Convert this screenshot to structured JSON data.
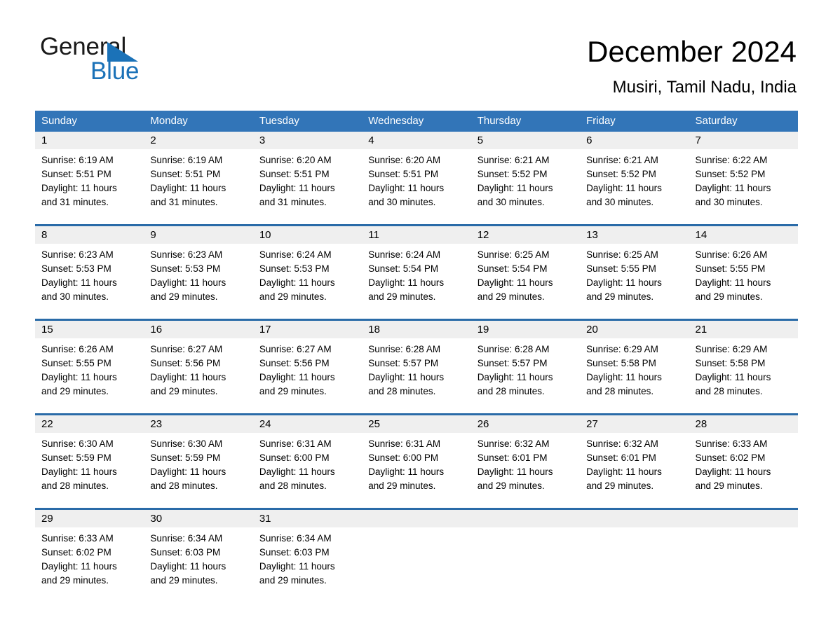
{
  "brand": {
    "name_primary": "General",
    "name_secondary": "Blue",
    "accent_color": "#1b72b8"
  },
  "header": {
    "title": "December 2024",
    "subtitle": "Musiri, Tamil Nadu, India"
  },
  "calendar": {
    "header_bg": "#3275b8",
    "row_divider_color": "#2a6ba8",
    "date_band_bg": "#efefef",
    "weekdays": [
      "Sunday",
      "Monday",
      "Tuesday",
      "Wednesday",
      "Thursday",
      "Friday",
      "Saturday"
    ],
    "weeks": [
      [
        {
          "date": "1",
          "lines": [
            "Sunrise: 6:19 AM",
            "Sunset: 5:51 PM",
            "Daylight: 11 hours",
            "and 31 minutes."
          ]
        },
        {
          "date": "2",
          "lines": [
            "Sunrise: 6:19 AM",
            "Sunset: 5:51 PM",
            "Daylight: 11 hours",
            "and 31 minutes."
          ]
        },
        {
          "date": "3",
          "lines": [
            "Sunrise: 6:20 AM",
            "Sunset: 5:51 PM",
            "Daylight: 11 hours",
            "and 31 minutes."
          ]
        },
        {
          "date": "4",
          "lines": [
            "Sunrise: 6:20 AM",
            "Sunset: 5:51 PM",
            "Daylight: 11 hours",
            "and 30 minutes."
          ]
        },
        {
          "date": "5",
          "lines": [
            "Sunrise: 6:21 AM",
            "Sunset: 5:52 PM",
            "Daylight: 11 hours",
            "and 30 minutes."
          ]
        },
        {
          "date": "6",
          "lines": [
            "Sunrise: 6:21 AM",
            "Sunset: 5:52 PM",
            "Daylight: 11 hours",
            "and 30 minutes."
          ]
        },
        {
          "date": "7",
          "lines": [
            "Sunrise: 6:22 AM",
            "Sunset: 5:52 PM",
            "Daylight: 11 hours",
            "and 30 minutes."
          ]
        }
      ],
      [
        {
          "date": "8",
          "lines": [
            "Sunrise: 6:23 AM",
            "Sunset: 5:53 PM",
            "Daylight: 11 hours",
            "and 30 minutes."
          ]
        },
        {
          "date": "9",
          "lines": [
            "Sunrise: 6:23 AM",
            "Sunset: 5:53 PM",
            "Daylight: 11 hours",
            "and 29 minutes."
          ]
        },
        {
          "date": "10",
          "lines": [
            "Sunrise: 6:24 AM",
            "Sunset: 5:53 PM",
            "Daylight: 11 hours",
            "and 29 minutes."
          ]
        },
        {
          "date": "11",
          "lines": [
            "Sunrise: 6:24 AM",
            "Sunset: 5:54 PM",
            "Daylight: 11 hours",
            "and 29 minutes."
          ]
        },
        {
          "date": "12",
          "lines": [
            "Sunrise: 6:25 AM",
            "Sunset: 5:54 PM",
            "Daylight: 11 hours",
            "and 29 minutes."
          ]
        },
        {
          "date": "13",
          "lines": [
            "Sunrise: 6:25 AM",
            "Sunset: 5:55 PM",
            "Daylight: 11 hours",
            "and 29 minutes."
          ]
        },
        {
          "date": "14",
          "lines": [
            "Sunrise: 6:26 AM",
            "Sunset: 5:55 PM",
            "Daylight: 11 hours",
            "and 29 minutes."
          ]
        }
      ],
      [
        {
          "date": "15",
          "lines": [
            "Sunrise: 6:26 AM",
            "Sunset: 5:55 PM",
            "Daylight: 11 hours",
            "and 29 minutes."
          ]
        },
        {
          "date": "16",
          "lines": [
            "Sunrise: 6:27 AM",
            "Sunset: 5:56 PM",
            "Daylight: 11 hours",
            "and 29 minutes."
          ]
        },
        {
          "date": "17",
          "lines": [
            "Sunrise: 6:27 AM",
            "Sunset: 5:56 PM",
            "Daylight: 11 hours",
            "and 29 minutes."
          ]
        },
        {
          "date": "18",
          "lines": [
            "Sunrise: 6:28 AM",
            "Sunset: 5:57 PM",
            "Daylight: 11 hours",
            "and 28 minutes."
          ]
        },
        {
          "date": "19",
          "lines": [
            "Sunrise: 6:28 AM",
            "Sunset: 5:57 PM",
            "Daylight: 11 hours",
            "and 28 minutes."
          ]
        },
        {
          "date": "20",
          "lines": [
            "Sunrise: 6:29 AM",
            "Sunset: 5:58 PM",
            "Daylight: 11 hours",
            "and 28 minutes."
          ]
        },
        {
          "date": "21",
          "lines": [
            "Sunrise: 6:29 AM",
            "Sunset: 5:58 PM",
            "Daylight: 11 hours",
            "and 28 minutes."
          ]
        }
      ],
      [
        {
          "date": "22",
          "lines": [
            "Sunrise: 6:30 AM",
            "Sunset: 5:59 PM",
            "Daylight: 11 hours",
            "and 28 minutes."
          ]
        },
        {
          "date": "23",
          "lines": [
            "Sunrise: 6:30 AM",
            "Sunset: 5:59 PM",
            "Daylight: 11 hours",
            "and 28 minutes."
          ]
        },
        {
          "date": "24",
          "lines": [
            "Sunrise: 6:31 AM",
            "Sunset: 6:00 PM",
            "Daylight: 11 hours",
            "and 28 minutes."
          ]
        },
        {
          "date": "25",
          "lines": [
            "Sunrise: 6:31 AM",
            "Sunset: 6:00 PM",
            "Daylight: 11 hours",
            "and 29 minutes."
          ]
        },
        {
          "date": "26",
          "lines": [
            "Sunrise: 6:32 AM",
            "Sunset: 6:01 PM",
            "Daylight: 11 hours",
            "and 29 minutes."
          ]
        },
        {
          "date": "27",
          "lines": [
            "Sunrise: 6:32 AM",
            "Sunset: 6:01 PM",
            "Daylight: 11 hours",
            "and 29 minutes."
          ]
        },
        {
          "date": "28",
          "lines": [
            "Sunrise: 6:33 AM",
            "Sunset: 6:02 PM",
            "Daylight: 11 hours",
            "and 29 minutes."
          ]
        }
      ],
      [
        {
          "date": "29",
          "lines": [
            "Sunrise: 6:33 AM",
            "Sunset: 6:02 PM",
            "Daylight: 11 hours",
            "and 29 minutes."
          ]
        },
        {
          "date": "30",
          "lines": [
            "Sunrise: 6:34 AM",
            "Sunset: 6:03 PM",
            "Daylight: 11 hours",
            "and 29 minutes."
          ]
        },
        {
          "date": "31",
          "lines": [
            "Sunrise: 6:34 AM",
            "Sunset: 6:03 PM",
            "Daylight: 11 hours",
            "and 29 minutes."
          ]
        },
        {
          "date": "",
          "lines": []
        },
        {
          "date": "",
          "lines": []
        },
        {
          "date": "",
          "lines": []
        },
        {
          "date": "",
          "lines": []
        }
      ]
    ]
  }
}
